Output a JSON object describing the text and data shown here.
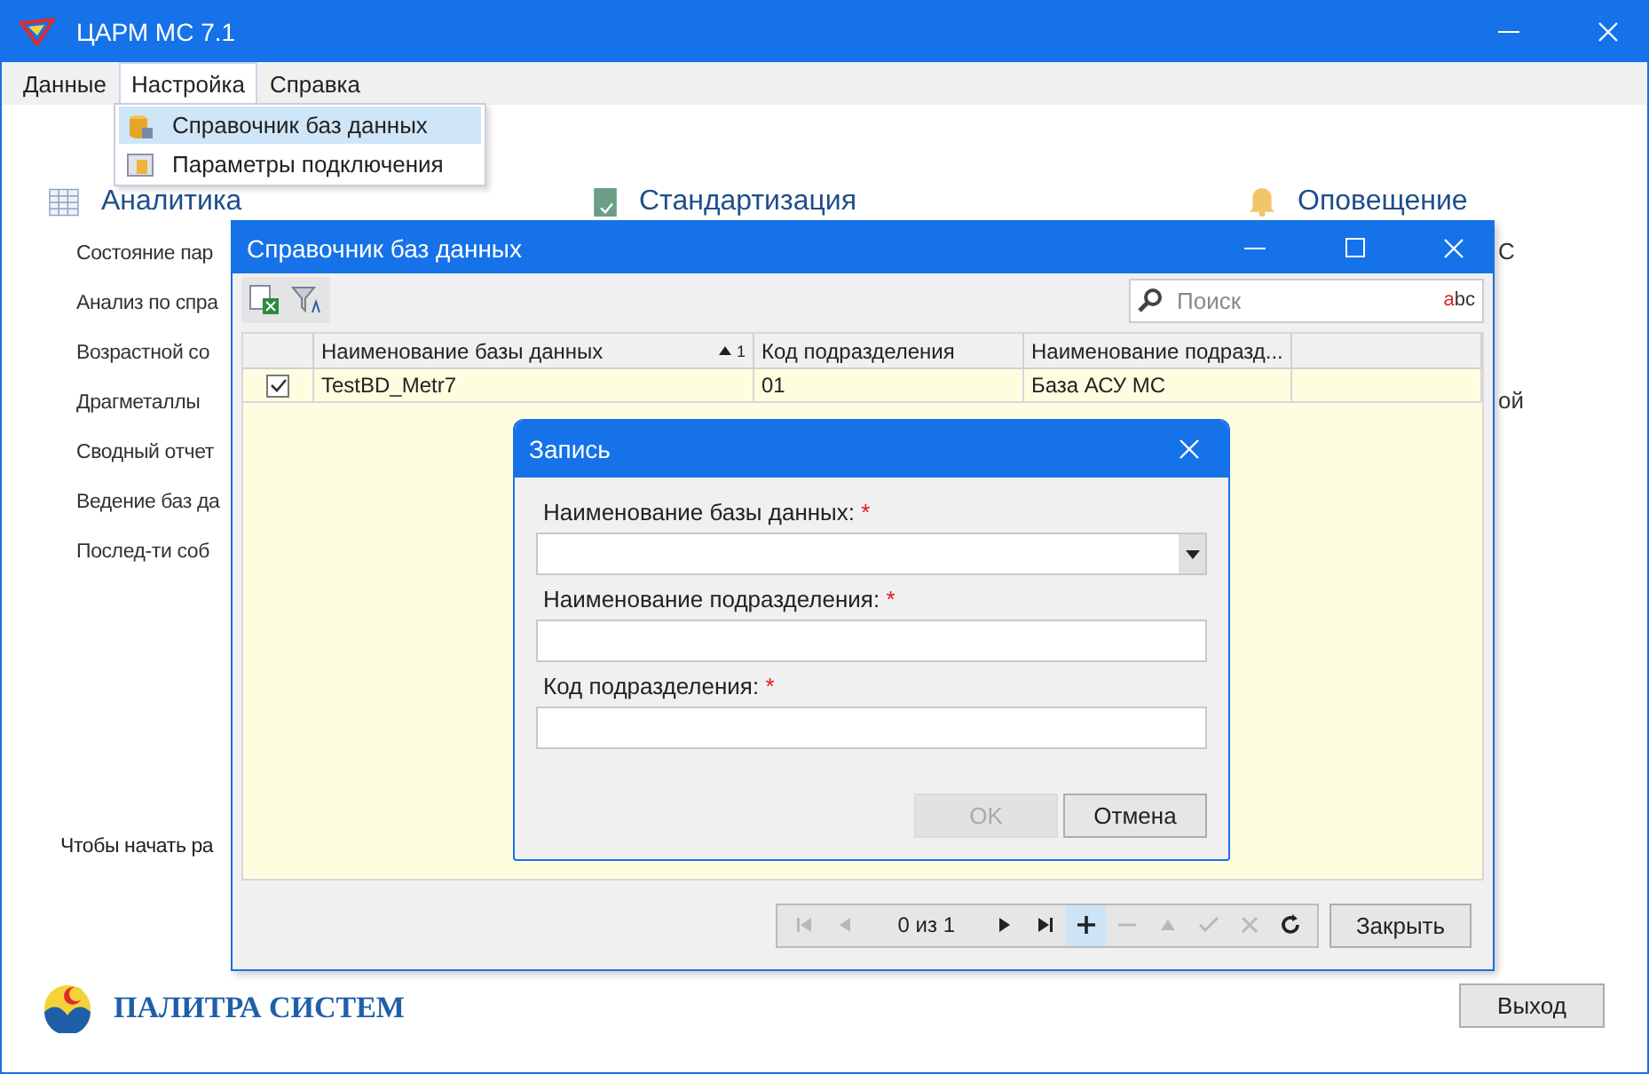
{
  "window": {
    "title": "ЦАРМ МС 7.1"
  },
  "menu": [
    {
      "label": "Данные",
      "selected": false
    },
    {
      "label": "Настройка",
      "selected": true
    },
    {
      "label": "Справка",
      "selected": false
    }
  ],
  "dropdown": [
    {
      "label": "Справочник баз данных",
      "selected": true,
      "kind": "database"
    },
    {
      "label": "Параметры подключения",
      "selected": false,
      "kind": "connection"
    }
  ],
  "sections": [
    {
      "title": "Аналитика",
      "kind": "table",
      "items": [
        "Состояние пар",
        "Анализ по спра",
        "Возрастной со",
        "Драгметаллы",
        "Сводный отчет",
        "Ведение баз да",
        "Послед-ти соб"
      ]
    },
    {
      "title": "Стандартизация",
      "kind": "book"
    },
    {
      "title": "Оповещение",
      "kind": "bell"
    }
  ],
  "right_fragments": [
    "С",
    "ой"
  ],
  "hint": "Чтобы начать ра",
  "logo": {
    "text": "ПАЛИТРА СИСТЕМ"
  },
  "exit_button": "Выход",
  "db_window": {
    "title": "Справочник баз данных",
    "search": {
      "placeholder": "Поиск",
      "spell_label": "abc"
    },
    "columns": [
      {
        "label": "Наименование базы данных",
        "sorted": true,
        "sort_index": "1"
      },
      {
        "label": "Код подразделения"
      },
      {
        "label": "Наименование подразд..."
      }
    ],
    "rows": [
      {
        "checked": true,
        "cells": [
          "TestBD_Metr7",
          "01",
          "База АСУ МС"
        ]
      }
    ],
    "pager": {
      "text": "0 из 1",
      "buttons": [
        {
          "kind": "first",
          "disabled": true,
          "selected": false
        },
        {
          "kind": "prev",
          "disabled": true,
          "selected": false
        },
        {
          "kind": "next",
          "disabled": false,
          "selected": false
        },
        {
          "kind": "last",
          "disabled": false,
          "selected": false
        },
        {
          "kind": "add",
          "disabled": false,
          "selected": true
        },
        {
          "kind": "remove",
          "disabled": true,
          "selected": false
        },
        {
          "kind": "up",
          "disabled": true,
          "selected": false
        },
        {
          "kind": "apply",
          "disabled": true,
          "selected": false
        },
        {
          "kind": "cancel",
          "disabled": true,
          "selected": false
        },
        {
          "kind": "refresh",
          "disabled": false,
          "selected": false
        }
      ]
    },
    "close_button": "Закрыть"
  },
  "record_dialog": {
    "title": "Запись",
    "required_mark": "*",
    "fields": [
      {
        "label": "Наименование базы данных:",
        "required": true,
        "kind": "dropdown"
      },
      {
        "label": "Наименование подразделения:",
        "required": true,
        "kind": "text"
      },
      {
        "label": "Код подразделения:",
        "required": true,
        "kind": "text"
      }
    ],
    "buttons": [
      {
        "label": "OK",
        "disabled": true
      },
      {
        "label": "Отмена",
        "disabled": false
      }
    ]
  }
}
